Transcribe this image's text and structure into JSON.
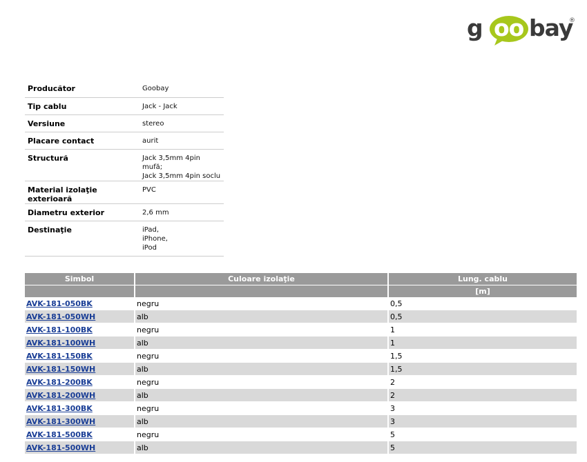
{
  "logo": {
    "text_a": "g",
    "text_oo": "oo",
    "text_b": "bay",
    "registered": "®",
    "brand_green": "#a7c71c",
    "text_color": "#3a3a3a"
  },
  "specs": [
    {
      "label": "Producător",
      "value": "Goobay"
    },
    {
      "label": "Tip cablu",
      "value": "Jack - Jack"
    },
    {
      "label": "Versiune",
      "value": "stereo"
    },
    {
      "label": "Placare contact",
      "value": "aurit"
    },
    {
      "label": "Structură",
      "value": "Jack 3,5mm 4pin mufă;\nJack 3,5mm 4pin soclu"
    },
    {
      "label": "Material izolaţie exterioară",
      "value": "PVC"
    },
    {
      "label": "Diametru exterior",
      "value": "2,6 mm"
    },
    {
      "label": "Destinaţie",
      "value": "iPad,\niPhone,\niPod"
    }
  ],
  "products": {
    "headers": [
      "Simbol",
      "Culoare izolaţie",
      "Lung. cablu"
    ],
    "units": [
      "",
      "",
      "[m]"
    ],
    "rows": [
      {
        "symbol": "AVK-181-050BK",
        "color": "negru",
        "length": "0,5"
      },
      {
        "symbol": "AVK-181-050WH",
        "color": "alb",
        "length": "0,5"
      },
      {
        "symbol": "AVK-181-100BK",
        "color": "negru",
        "length": "1"
      },
      {
        "symbol": "AVK-181-100WH",
        "color": "alb",
        "length": "1"
      },
      {
        "symbol": "AVK-181-150BK",
        "color": "negru",
        "length": "1,5"
      },
      {
        "symbol": "AVK-181-150WH",
        "color": "alb",
        "length": "1,5"
      },
      {
        "symbol": "AVK-181-200BK",
        "color": "negru",
        "length": "2"
      },
      {
        "symbol": "AVK-181-200WH",
        "color": "alb",
        "length": "2"
      },
      {
        "symbol": "AVK-181-300BK",
        "color": "negru",
        "length": "3"
      },
      {
        "symbol": "AVK-181-300WH",
        "color": "alb",
        "length": "3"
      },
      {
        "symbol": "AVK-181-500BK",
        "color": "negru",
        "length": "5"
      },
      {
        "symbol": "AVK-181-500WH",
        "color": "alb",
        "length": "5"
      }
    ]
  }
}
